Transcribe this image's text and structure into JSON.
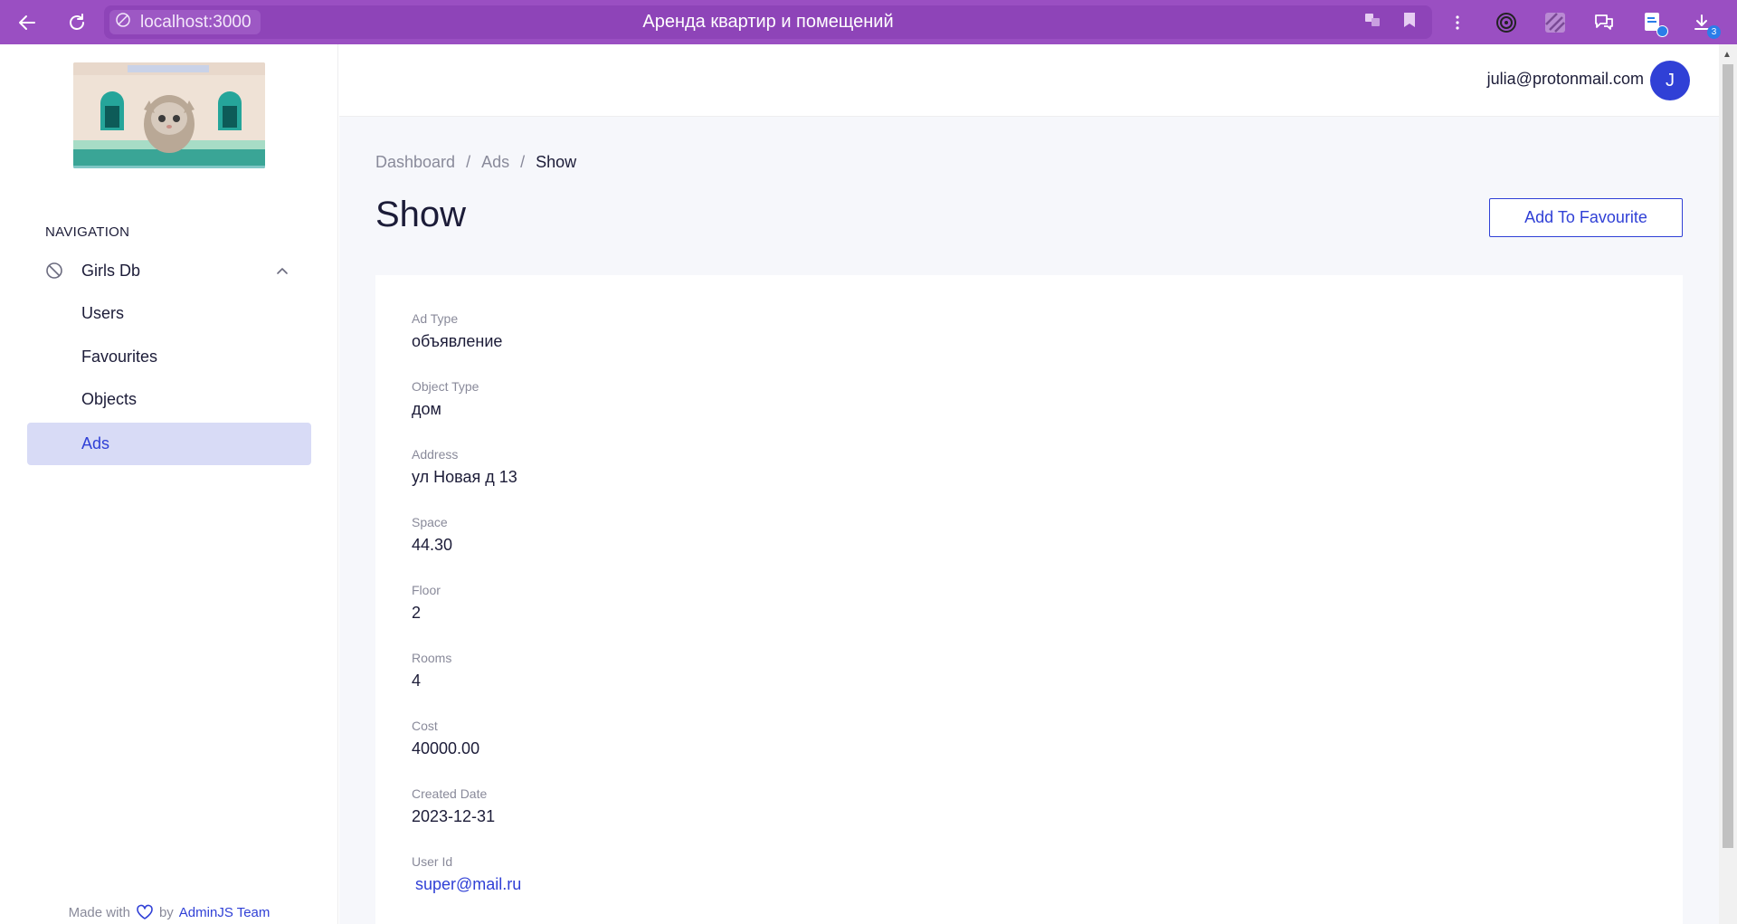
{
  "browser": {
    "url": "localhost:3000",
    "page_title": "Аренда квартир и помещений",
    "download_count": "3",
    "icons": [
      "back-arrow-icon",
      "reload-icon",
      "site-info-icon",
      "translate-icon",
      "bookmark-icon",
      "menu-dots-icon",
      "target-extension-icon",
      "stripes-extension-icon",
      "chat-extension-icon",
      "document-extension-icon",
      "downloads-icon"
    ]
  },
  "sidebar": {
    "nav_heading": "NAVIGATION",
    "group": {
      "label": "Girls Db",
      "icon": "prohibited-icon",
      "expanded": true
    },
    "items": [
      {
        "label": "Users",
        "active": false
      },
      {
        "label": "Favourites",
        "active": false
      },
      {
        "label": "Objects",
        "active": false
      },
      {
        "label": "Ads",
        "active": true
      }
    ],
    "footer": {
      "made_with": "Made with",
      "by": "by",
      "team": "AdminJS Team"
    }
  },
  "header": {
    "user_email": "julia@protonmail.com",
    "avatar_initial": "J"
  },
  "breadcrumb": [
    "Dashboard",
    "Ads",
    "Show"
  ],
  "page": {
    "title": "Show",
    "favourite_button": "Add To Favourite"
  },
  "record": {
    "fields": [
      {
        "label": "Ad Type",
        "value": "объявление"
      },
      {
        "label": "Object Type",
        "value": "дом"
      },
      {
        "label": "Address",
        "value": "ул Новая д 13"
      },
      {
        "label": "Space",
        "value": "44.30"
      },
      {
        "label": "Floor",
        "value": "2"
      },
      {
        "label": "Rooms",
        "value": "4"
      },
      {
        "label": "Cost",
        "value": "40000.00"
      },
      {
        "label": "Created Date",
        "value": "2023-12-31"
      },
      {
        "label": "User Id",
        "value": "super@mail.ru"
      }
    ]
  },
  "colors": {
    "browser_bar": "#9a4fc2",
    "primary": "#3040d6",
    "active_nav_bg": "#d8dbf6",
    "main_bg": "#f6f7fb"
  }
}
